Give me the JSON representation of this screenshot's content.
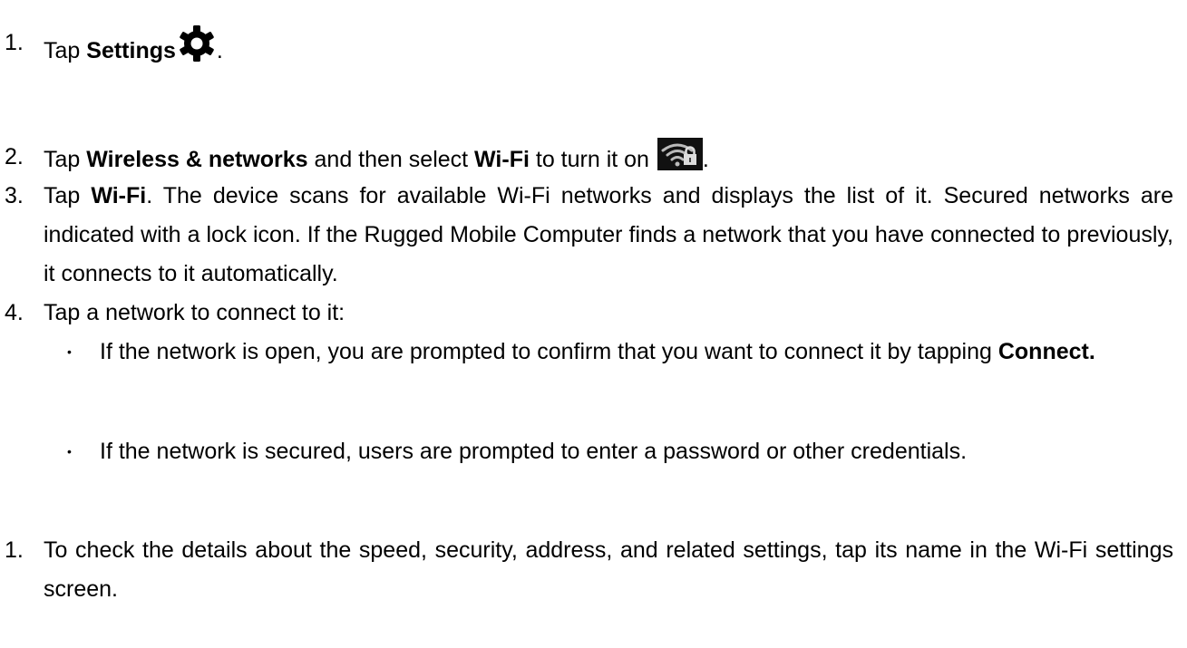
{
  "steps": [
    {
      "num": "1.",
      "before": "Tap ",
      "bold": "Settings",
      "after": "."
    },
    {
      "num": "2.",
      "a": "Tap ",
      "b1": "Wireless & networks",
      "c": " and then select ",
      "b2": "Wi-Fi",
      "d": " to turn it on ",
      "e": "."
    },
    {
      "num": "3.",
      "a": "Tap ",
      "b": "Wi-Fi",
      "c": ". The device scans for available Wi-Fi networks and displays the list of it. Secured networks are indicated with a lock icon. If the Rugged Mobile Computer finds a network that you have connected to previously, it connects to it automatically."
    },
    {
      "num": "4.",
      "text": "Tap a network to connect to it:"
    },
    {
      "num": "1.",
      "text": "To check the details about the speed, security, address, and related settings, tap its name in the Wi-Fi settings screen."
    }
  ],
  "bullets": [
    {
      "a": "If the network is open, you are prompted to confirm that you want to connect it by tapping ",
      "b": "Connect."
    },
    {
      "text": "If the network is secured, users are prompted to enter a password or other credentials."
    }
  ],
  "bullet_char": "•",
  "icons": {
    "settings": "gear-icon",
    "wifi": "wifi-lock-icon"
  }
}
